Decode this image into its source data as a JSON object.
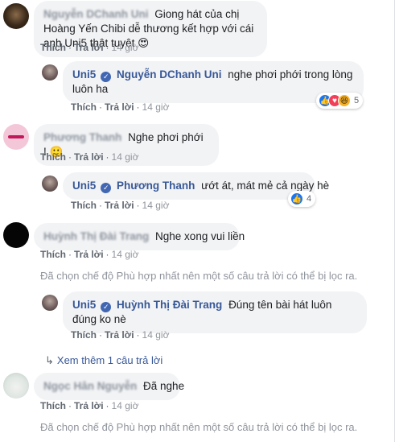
{
  "action_labels": {
    "like": "Thích",
    "reply": "Trả lời",
    "separator": "·"
  },
  "comments": [
    {
      "author": "Nguyễn DChanh Uni",
      "text": "Giong hát của chị Hoàng Yến Chibi dễ thương kết hợp với cái anh Uni5 thật tuyệt",
      "emoji": "😍",
      "time": "14 giờ"
    },
    {
      "author": "Uni5",
      "verified": true,
      "mention": "Nguyễn DChanh Uni",
      "text": "nghe phơi phới trong lòng luôn ha",
      "time": "14 giờ",
      "reaction_count": "5"
    },
    {
      "author": "Phương Thanh",
      "text": "Nghe phơi phới !",
      "emoji": "🙂",
      "time": "14 giờ"
    },
    {
      "author": "Uni5",
      "verified": true,
      "mention": "Phương Thanh",
      "text": "ướt át, mát mẻ cả ngày hè",
      "time": "14 giờ",
      "reaction_count": "4"
    },
    {
      "author": "Huỳnh Thị Đài Trang",
      "text": "Nghe xong vui liền",
      "time": "14 giờ"
    },
    {
      "author": "Uni5",
      "verified": true,
      "mention": "Huỳnh Thị Đài Trang",
      "text": "Đúng tên bài hát luôn đúng ko nè",
      "time": "14 giờ"
    },
    {
      "author": "Ngọc Hân Nguyễn",
      "text": "Đã nghe",
      "time": "14 giờ"
    }
  ],
  "filter_note": "Đã chọn chế độ Phù hợp nhất nên một số câu trả lời có thể bị lọc ra.",
  "view_more": "Xem thêm 1 câu trả lời",
  "colors": {
    "link": "#385898",
    "bubble": "#f2f3f5",
    "muted": "#90949c",
    "verified": "#4267b2"
  }
}
